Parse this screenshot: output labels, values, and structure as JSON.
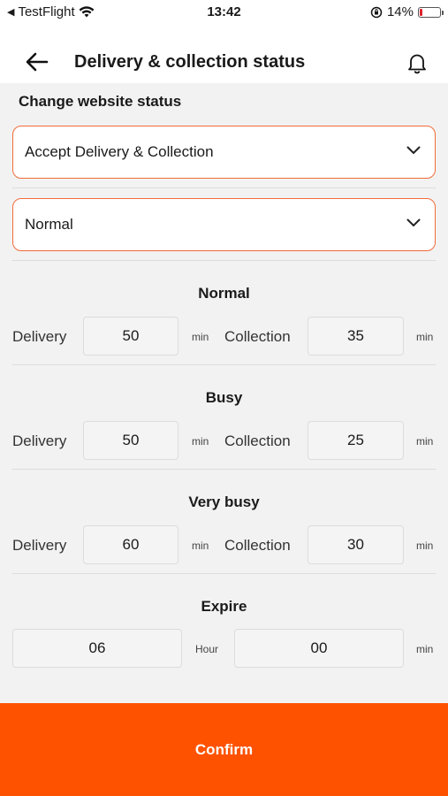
{
  "status_bar": {
    "app_back": "TestFlight",
    "time": "13:42",
    "battery": "14%"
  },
  "header": {
    "title": "Delivery & collection status"
  },
  "website_status": {
    "label": "Change website status",
    "mode_value": "Accept Delivery & Collection",
    "level_value": "Normal"
  },
  "groups": [
    {
      "title": "Normal",
      "delivery_label": "Delivery",
      "delivery_value": "50",
      "collection_label": "Collection",
      "collection_value": "35",
      "unit": "min"
    },
    {
      "title": "Busy",
      "delivery_label": "Delivery",
      "delivery_value": "50",
      "collection_label": "Collection",
      "collection_value": "25",
      "unit": "min"
    },
    {
      "title": "Very busy",
      "delivery_label": "Delivery",
      "delivery_value": "60",
      "collection_label": "Collection",
      "collection_value": "30",
      "unit": "min"
    }
  ],
  "expire": {
    "title": "Expire",
    "hour_value": "06",
    "hour_unit": "Hour",
    "min_value": "00",
    "min_unit": "min"
  },
  "confirm_label": "Confirm",
  "colors": {
    "accent": "#fe5200",
    "select_border": "#f26b3a"
  }
}
